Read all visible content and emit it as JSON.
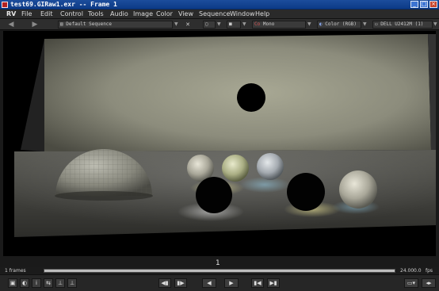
{
  "window": {
    "title": "test69.GIRaw1.exr -- Frame 1",
    "minimize_glyph": "_",
    "maximize_glyph": "□",
    "close_glyph": "×"
  },
  "menubar": {
    "logo": "RV",
    "items": [
      "File",
      "Edit",
      "Control",
      "Tools",
      "Audio",
      "Image",
      "Color",
      "View",
      "Sequence",
      "Window",
      "Help"
    ]
  },
  "toolbar": {
    "back_glyph": "◀",
    "forward_glyph": "▶",
    "sequence_label": "Default Sequence",
    "channel_label": "Mono",
    "channel_prefix": "Co",
    "color_label": "Color (RGB)",
    "display_label": "DELL U2412M (1)"
  },
  "timeline": {
    "frames_label": "1 frames",
    "current_frame": "1",
    "fps_value": "24.00",
    "fps_actual": "0.0",
    "fps_unit": "fps"
  },
  "bottombar": {
    "buttons": [
      "▣",
      "◐",
      "i",
      "⇆",
      "⊥",
      "⊥"
    ],
    "step_back": "◀▮",
    "step_fwd": "▮▶",
    "play_back": "◀",
    "play_fwd": "▶",
    "jump_start": "▮◀",
    "jump_end": "▶▮",
    "right_buttons": [
      "▭▾",
      "◂▸"
    ]
  },
  "colors": {
    "titlebar": "#0c3a86",
    "viewer_background": "#000000"
  }
}
